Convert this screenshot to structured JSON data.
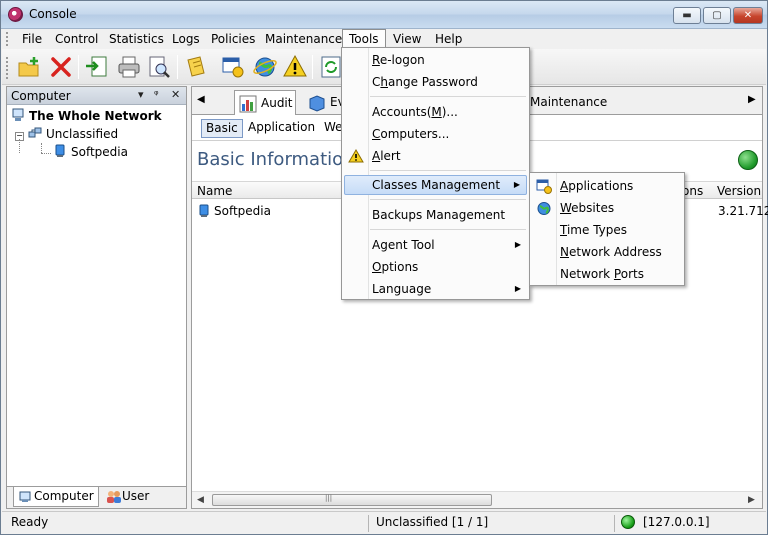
{
  "window": {
    "title": "Console",
    "minimize": "▬",
    "maximize": "▢",
    "close": "✕"
  },
  "menubar": [
    "File",
    "Control",
    "Statistics",
    "Logs",
    "Policies",
    "Maintenance",
    "Tools",
    "View",
    "Help"
  ],
  "left_panel": {
    "header": "Computer",
    "pin": "ᵠ",
    "dropdown_caret": "▾",
    "close": "✕",
    "tree": {
      "root": "The Whole Network",
      "group": "Unclassified",
      "computer": "Softpedia"
    },
    "tabs": {
      "computer": "Computer",
      "user": "User"
    }
  },
  "doc_tabs": {
    "audit": "Audit",
    "events": "Ev",
    "maintenance": "Maintenance",
    "left_arrow": "◀",
    "right_arrow": "▶"
  },
  "sub_tabs": {
    "basic": "Basic",
    "application": "Application",
    "web": "We"
  },
  "section_title": "Basic Informatio",
  "grid": {
    "columns": {
      "name": "Name",
      "options": "ons",
      "version": "Version"
    },
    "rows": [
      {
        "name": "Softpedia",
        "version": "3.21.712"
      }
    ]
  },
  "tools_menu": {
    "relogon": {
      "pre": "",
      "ul": "R",
      "post": "e-logon"
    },
    "change_password": {
      "pre": "C",
      "ul": "h",
      "post": "ange Password"
    },
    "accounts": {
      "pre": "Accounts(",
      "ul": "M",
      "post": ")..."
    },
    "computers": {
      "pre": "",
      "ul": "C",
      "post": "omputers..."
    },
    "alert": {
      "pre": "",
      "ul": "A",
      "post": "lert"
    },
    "classes_management": "Classes Management",
    "backups_management": "Backups Management",
    "agent_tool": "Agent Tool",
    "options": {
      "pre": "",
      "ul": "O",
      "post": "ptions"
    },
    "language": "Language",
    "arrow": "▶"
  },
  "classes_submenu": {
    "applications": {
      "pre": "",
      "ul": "A",
      "post": "pplications"
    },
    "websites": {
      "pre": "",
      "ul": "W",
      "post": "ebsites"
    },
    "time_types": {
      "pre": "",
      "ul": "T",
      "post": "ime Types"
    },
    "network_address": {
      "pre": "",
      "ul": "N",
      "post": "etwork Address"
    },
    "network_ports": {
      "pre": "Network ",
      "ul": "P",
      "post": "orts"
    }
  },
  "statusbar": {
    "status": "Ready",
    "group": "Unclassified [1 / 1]",
    "ip": "[127.0.0.1]"
  },
  "colors": {
    "accent": "#3d5a80",
    "highlight": "#c6dcf7",
    "online": "#1aa01a"
  }
}
